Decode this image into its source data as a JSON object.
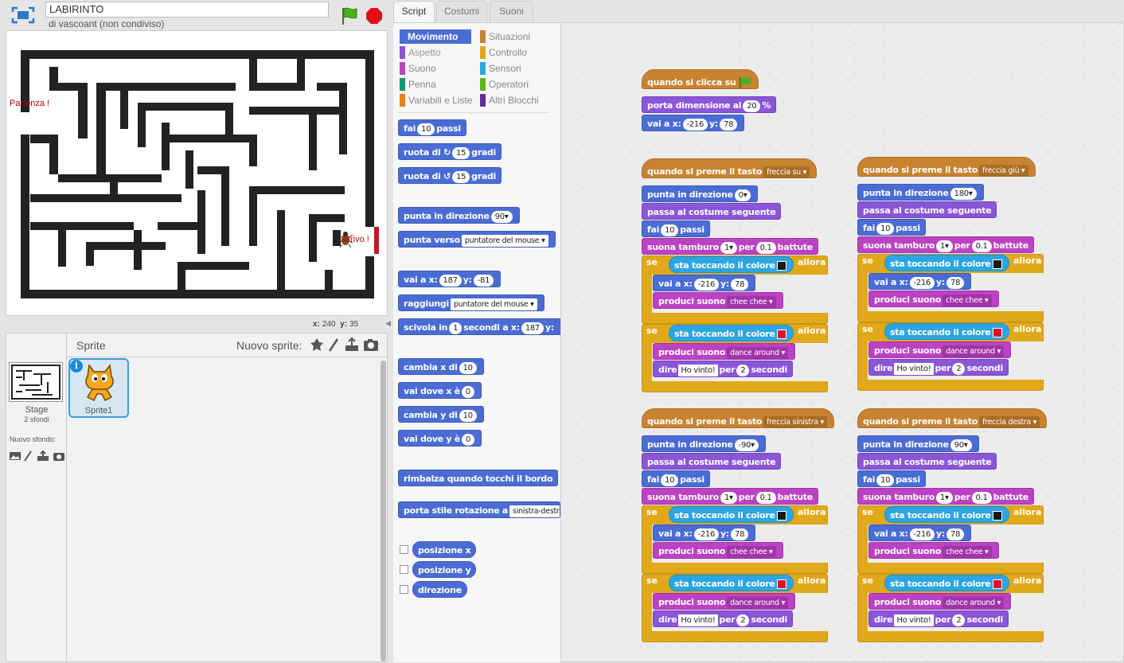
{
  "project": {
    "title": "LABIRINTO",
    "author": "di vascoant (non condiviso)"
  },
  "stage": {
    "start_label": "Partenza !",
    "end_label": "Arrivo !",
    "mouse_x": "240",
    "mouse_y": "35",
    "x_label": "x:",
    "y_label": "y:"
  },
  "sprites_panel": {
    "title": "Sprite",
    "new_sprite": "Nuovo sprite:",
    "stage_name": "Stage",
    "stage_backdrops": "2 sfondi",
    "new_backdrop": "Nuovo sfondo:",
    "sprite_name": "Sprite1",
    "info": "i"
  },
  "tabs": [
    "Script",
    "Costumi",
    "Suoni"
  ],
  "categories": [
    {
      "label": "Movimento",
      "color": "#4a6cd4"
    },
    {
      "label": "Aspetto",
      "color": "#8a55d7"
    },
    {
      "label": "Suono",
      "color": "#bb42c3"
    },
    {
      "label": "Penna",
      "color": "#0e9a6c"
    },
    {
      "label": "Variabili e Liste",
      "color": "#ee7d16"
    },
    {
      "label": "Situazioni",
      "color": "#c88330"
    },
    {
      "label": "Controllo",
      "color": "#e1a91a"
    },
    {
      "label": "Sensori",
      "color": "#2ca5e2"
    },
    {
      "label": "Operatori",
      "color": "#5cb712"
    },
    {
      "label": "Altri Blocchi",
      "color": "#632d99"
    }
  ],
  "palette": {
    "fai": "fai",
    "fai_val": "10",
    "passi": "passi",
    "ruota": "ruota di",
    "ruota_val": "15",
    "gradi": "gradi",
    "punta_dir": "punta in direzione",
    "punta_dir_val": "90",
    "punta_verso": "punta verso",
    "punta_verso_val": "puntatore del mouse",
    "vai": "vai a x:",
    "vai_x": "187",
    "y": "y:",
    "vai_y": "-81",
    "raggiungi": "raggiungi",
    "raggiungi_val": "puntatore del mouse",
    "scivola": "scivola in",
    "scivola_s": "1",
    "secondi_ax": "secondi a x:",
    "scivola_x": "187",
    "cambia_x": "cambia x di",
    "cambia_x_val": "10",
    "vai_dove_x": "vai dove x è",
    "vai_dove_x_val": "0",
    "cambia_y": "cambia y di",
    "cambia_y_val": "10",
    "vai_dove_y": "vai dove y è",
    "vai_dove_y_val": "0",
    "rimbalza": "rimbalza quando tocchi il bordo",
    "stile": "porta stile rotazione a",
    "stile_val": "sinistra-destra",
    "pos_x": "posizione x",
    "pos_y": "posizione y",
    "direzione": "direzione"
  },
  "scripts": {
    "flag_hat": "quando si clicca su",
    "dim": "porta dimensione al",
    "dim_val": "20",
    "pct": "%",
    "vai_xy": "vai a x:",
    "start_x": "-216",
    "y": "y:",
    "start_y": "78",
    "press": "quando si preme il tasto",
    "keys": [
      "freccia su",
      "freccia giù",
      "freccia sinistra",
      "freccia destra"
    ],
    "dirs": [
      "0",
      "180",
      "-90",
      "90"
    ],
    "punta": "punta in direzione",
    "costume": "passa al costume seguente",
    "fai": "fai",
    "passi": "passi",
    "step": "10",
    "tamburo": "suona tamburo",
    "drum": "1",
    "per": "per",
    "beat": "0.1",
    "battute": "battute",
    "se": "se",
    "toccando": "sta toccando il colore",
    "allora": "allora",
    "produci": "produci suono",
    "sound1": "chee chee",
    "sound2": "dance around",
    "dire": "dire",
    "msg": "Ho vinto!",
    "per2": "per",
    "sec": "2",
    "secondi": "secondi",
    "color_black": "#1a1a1a",
    "color_red": "#e0102a"
  }
}
